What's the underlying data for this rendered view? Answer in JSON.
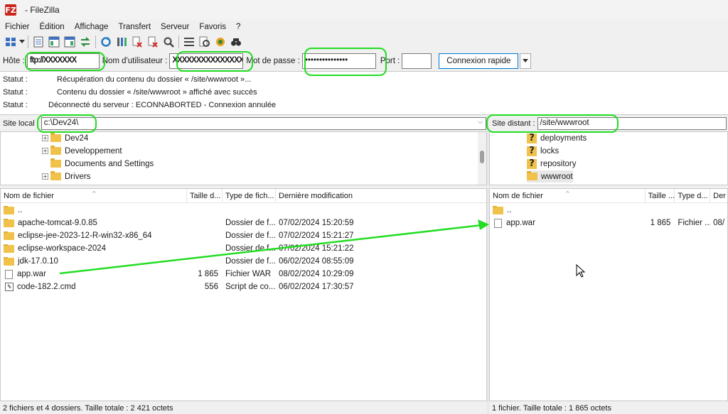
{
  "window": {
    "title": "- FileZilla",
    "logo": "FZ"
  },
  "menu": [
    {
      "label": "Fichier"
    },
    {
      "label": "Édition"
    },
    {
      "label": "Affichage"
    },
    {
      "label": "Transfert"
    },
    {
      "label": "Serveur"
    },
    {
      "label": "Favoris"
    },
    {
      "label": "?"
    }
  ],
  "toolbar_icons": [
    "site-manager-icon",
    "dropdown-arrow-icon",
    "toggle-log-icon",
    "toggle-local-tree-icon",
    "toggle-remote-tree-icon",
    "toggle-queue-icon",
    "refresh-icon",
    "process-queue-icon",
    "cancel-operation-icon",
    "disconnect-icon",
    "reconnect-icon",
    "directory-filter-icon",
    "sync-browsing-icon",
    "compare-directories-icon",
    "search-remote-icon"
  ],
  "quickconnect": {
    "host_label": "Hôte :",
    "host_value": "ftp://XXXXXXX",
    "user_label": "Nom d'utilisateur :",
    "user_value": "XXXXXXXXXXXXXXX",
    "pass_label": "Mot de passe :",
    "pass_value": "•••••••••••••••",
    "port_label": "Port :",
    "port_value": "",
    "connect_button": "Connexion rapide"
  },
  "log": [
    {
      "label": "Statut :",
      "message": "Récupération du contenu du dossier « /site/wwwroot »..."
    },
    {
      "label": "Statut :",
      "message": "Contenu du dossier « /site/wwwroot » affiché avec succès"
    },
    {
      "label": "Statut :",
      "message": "Déconnecté du serveur : ECONNABORTED - Connexion annulée"
    }
  ],
  "local": {
    "path_label": "Site local :",
    "path_value": "c:\\Dev24\\",
    "tree": [
      {
        "name": "Dev24",
        "expandable": true
      },
      {
        "name": "Developpement",
        "expandable": true
      },
      {
        "name": "Documents and Settings",
        "expandable": false
      },
      {
        "name": "Drivers",
        "expandable": true
      }
    ],
    "columns": [
      "Nom de fichier",
      "Taille d...",
      "Type de fich...",
      "Dernière modification"
    ],
    "files": [
      {
        "name": "..",
        "size": "",
        "type": "",
        "modified": "",
        "icon": "folder"
      },
      {
        "name": "apache-tomcat-9.0.85",
        "size": "",
        "type": "Dossier de f...",
        "modified": "07/02/2024 15:20:59",
        "icon": "folder"
      },
      {
        "name": "eclipse-jee-2023-12-R-win32-x86_64",
        "size": "",
        "type": "Dossier de f...",
        "modified": "07/02/2024 15:21:27",
        "icon": "folder"
      },
      {
        "name": "eclipse-workspace-2024",
        "size": "",
        "type": "Dossier de f...",
        "modified": "07/02/2024 15:21:22",
        "icon": "folder"
      },
      {
        "name": "jdk-17.0.10",
        "size": "",
        "type": "Dossier de f...",
        "modified": "06/02/2024 08:55:09",
        "icon": "folder"
      },
      {
        "name": "app.war",
        "size": "1 865",
        "type": "Fichier WAR",
        "modified": "08/02/2024 10:29:09",
        "icon": "file"
      },
      {
        "name": "code-182.2.cmd",
        "size": "556",
        "type": "Script de co...",
        "modified": "06/02/2024 17:30:57",
        "icon": "cmd"
      }
    ],
    "status": "2 fichiers et 4 dossiers. Taille totale : 2 421 octets"
  },
  "remote": {
    "path_label": "Site distant :",
    "path_value": "/site/wwwroot",
    "tree": [
      {
        "name": "deployments",
        "icon": "unknown"
      },
      {
        "name": "locks",
        "icon": "unknown"
      },
      {
        "name": "repository",
        "icon": "unknown"
      },
      {
        "name": "wwwroot",
        "icon": "folder"
      }
    ],
    "columns": [
      "Nom de fichier",
      "Taille ...",
      "Type d...",
      "Der"
    ],
    "files": [
      {
        "name": "..",
        "size": "",
        "type": "",
        "modified": "",
        "icon": "folder"
      },
      {
        "name": "app.war",
        "size": "1 865",
        "type": "Fichier ...",
        "modified": "08/",
        "icon": "file"
      }
    ],
    "status": "1 fichier. Taille totale : 1 865 octets"
  },
  "annotation_color": "#22dd22"
}
